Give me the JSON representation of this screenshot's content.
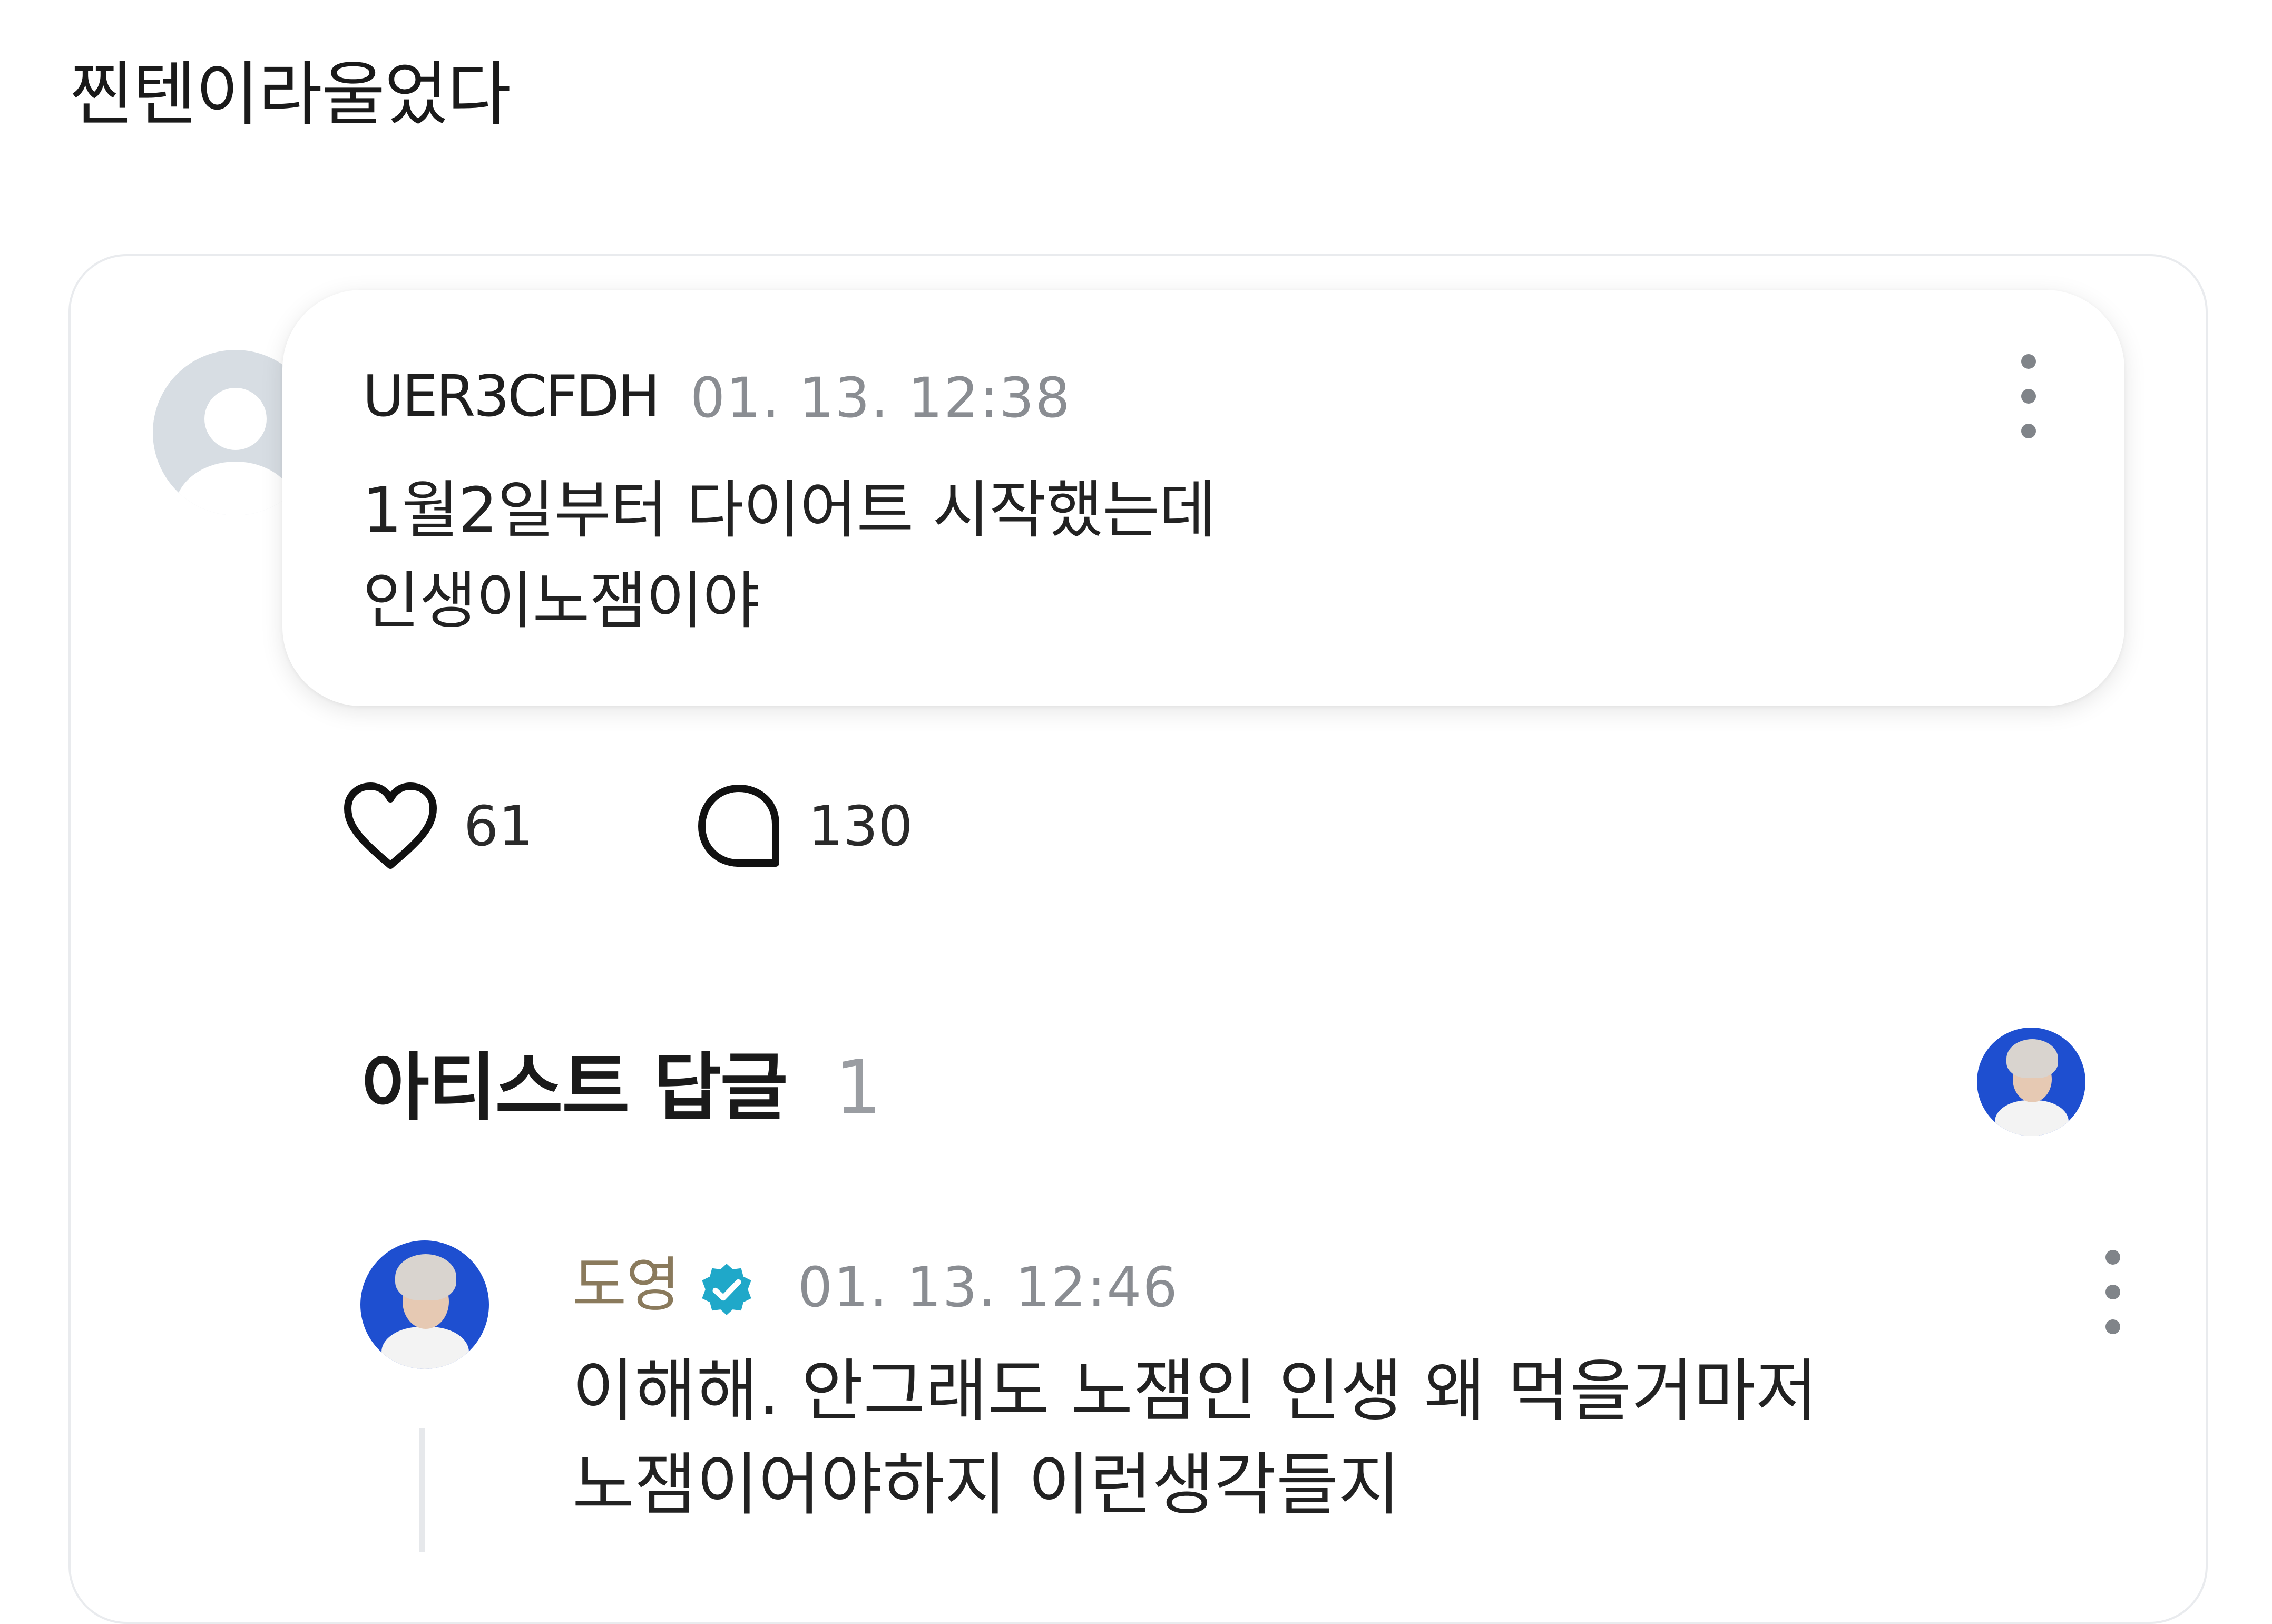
{
  "post": {
    "title": "찐텐이라울었다"
  },
  "comment": {
    "author": "UER3CFDH",
    "timestamp": "01. 13. 12:38",
    "lines": [
      "1월2일부터 다이어트 시작했는데",
      "인생이노잼이야"
    ],
    "likes": "61",
    "replies": "130",
    "avatar_icon": "default-user-avatar",
    "more_icon": "kebab-menu-icon"
  },
  "artist_replies": {
    "heading": "아티스트 답글",
    "count": "1",
    "accent_color": "#1fa8c9"
  },
  "reply": {
    "author": "도영",
    "badge_icon": "verified-badge-icon",
    "timestamp": "01. 13. 12:46",
    "lines": [
      "이해해.  안그래도 노잼인 인생 왜 먹을거마저",
      "노잼이어야하지 이런생각들지"
    ],
    "more_icon": "kebab-menu-icon"
  }
}
